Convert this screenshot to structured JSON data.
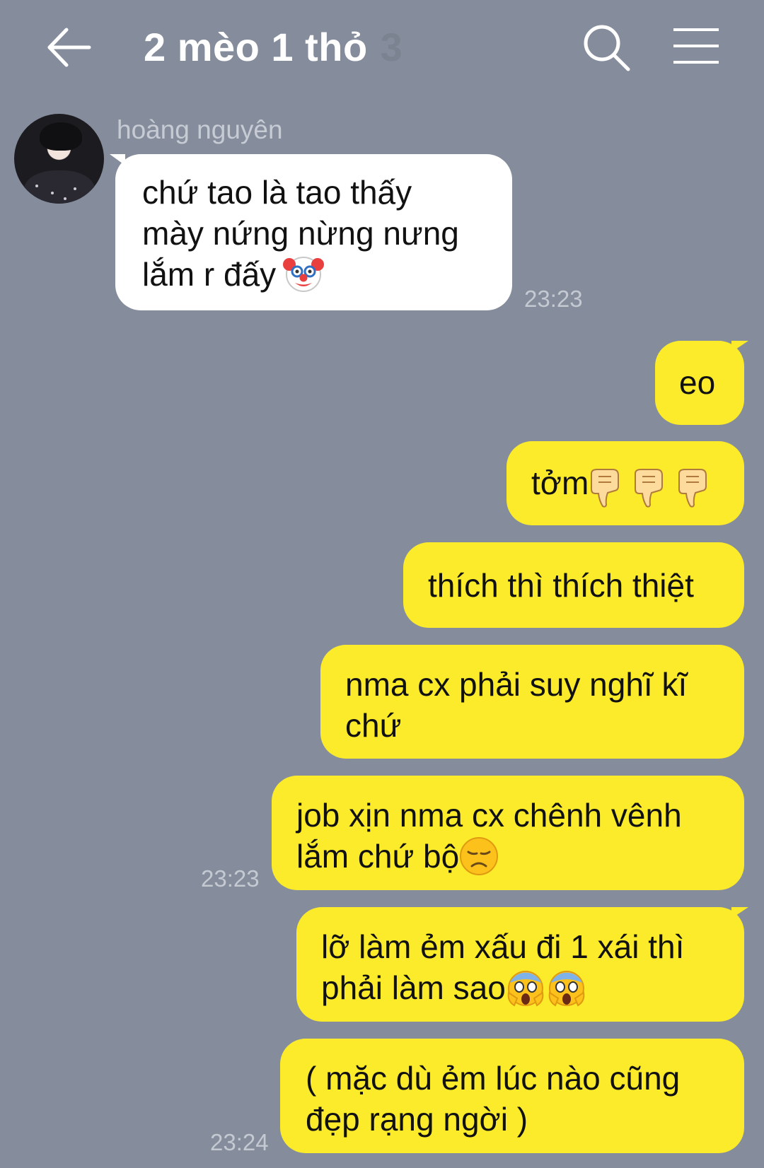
{
  "header": {
    "title": "2 mèo 1 thỏ",
    "member_count": "3",
    "icons": {
      "back": "arrow-left-icon",
      "search": "search-icon",
      "menu": "hamburger-menu-icon"
    }
  },
  "colors": {
    "background": "#858d9c",
    "outgoing_bubble": "#fbeb2a",
    "incoming_bubble": "#ffffff"
  },
  "incoming": {
    "sender": "hoàng nguyên",
    "avatar": "avatar-photo",
    "text": "chứ tao là tao thấy\nmày nứng nừng nưng\nlắm r đấy",
    "emoji": "clown-face-emoji",
    "time": "23:23"
  },
  "outgoing": [
    {
      "text": "eo"
    },
    {
      "text": "tởm",
      "emoji": "thumbs-down-emoji x3"
    },
    {
      "text": "thích thì thích thiệt"
    },
    {
      "text": "nma cx phải suy nghĩ kĩ\nchứ"
    },
    {
      "text": "job xịn nma cx chênh vênh\nlắm chứ bộ",
      "emoji": "disappointed-face-emoji",
      "time": "23:23"
    },
    {
      "text": "lỡ làm ẻm xấu đi 1 xái thì\nphải làm sao",
      "emoji": "screaming-face-emoji x2"
    },
    {
      "text": "( mặc dù ẻm lúc nào cũng\nđẹp rạng ngời )",
      "time": "23:24"
    }
  ]
}
